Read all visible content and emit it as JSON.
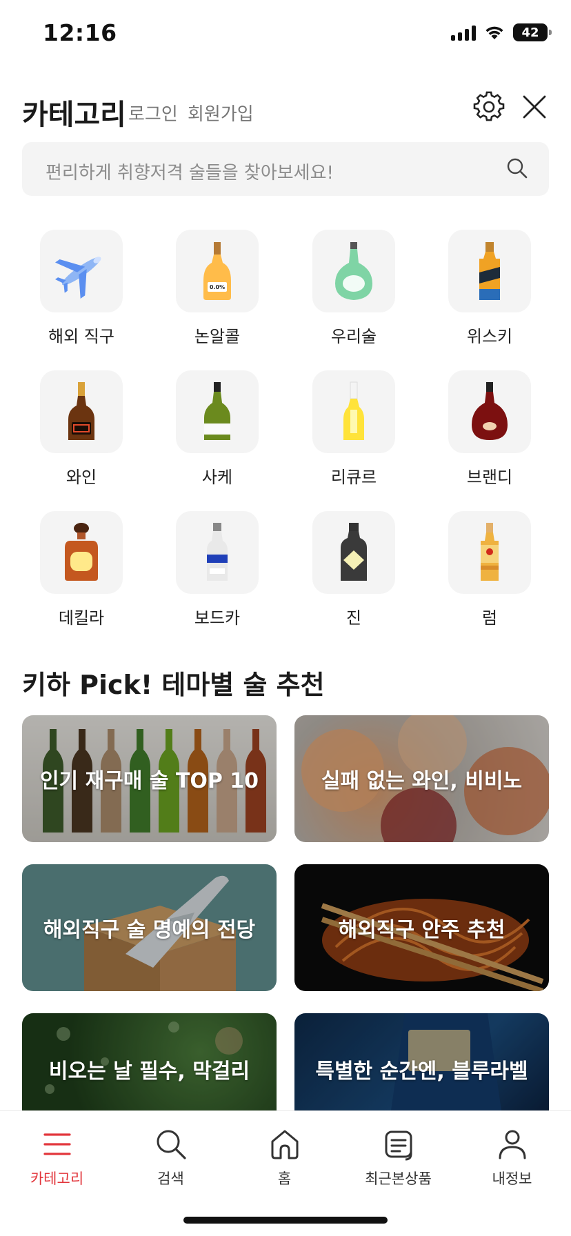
{
  "status": {
    "time": "12:16",
    "battery": "42"
  },
  "header": {
    "title": "카테고리",
    "login": "로그인",
    "signup": "회원가입"
  },
  "search": {
    "placeholder": "편리하게 취향저격 술들을 찾아보세요!"
  },
  "categories": [
    {
      "label": "해외 직구",
      "icon": "airplane-icon"
    },
    {
      "label": "논알콜",
      "icon": "non-alcohol-bottle-icon",
      "badge": "0.0%"
    },
    {
      "label": "우리술",
      "icon": "korean-liquor-bottle-icon"
    },
    {
      "label": "위스키",
      "icon": "whisky-bottle-icon"
    },
    {
      "label": "와인",
      "icon": "wine-bottle-icon"
    },
    {
      "label": "사케",
      "icon": "sake-bottle-icon"
    },
    {
      "label": "리큐르",
      "icon": "liqueur-bottle-icon"
    },
    {
      "label": "브랜디",
      "icon": "brandy-bottle-icon"
    },
    {
      "label": "데킬라",
      "icon": "tequila-bottle-icon"
    },
    {
      "label": "보드카",
      "icon": "vodka-bottle-icon"
    },
    {
      "label": "진",
      "icon": "gin-bottle-icon"
    },
    {
      "label": "럼",
      "icon": "rum-bottle-icon"
    }
  ],
  "section": {
    "title": "키하 Pick! 테마별 술 추천"
  },
  "themes": [
    {
      "label": "인기 재구매 술 TOP 10"
    },
    {
      "label": "실패 없는 와인, 비비노"
    },
    {
      "label": "해외직구 술 명예의 전당"
    },
    {
      "label": "해외직구 안주 추천"
    },
    {
      "label": "비오는 날 필수, 막걸리"
    },
    {
      "label": "특별한 순간엔, 블루라벨"
    }
  ],
  "tabs": [
    {
      "label": "카테고리",
      "icon": "menu-icon",
      "active": true
    },
    {
      "label": "검색",
      "icon": "search-icon"
    },
    {
      "label": "홈",
      "icon": "home-icon"
    },
    {
      "label": "최근본상품",
      "icon": "recent-items-icon"
    },
    {
      "label": "내정보",
      "icon": "profile-icon"
    }
  ],
  "colors": {
    "accent": "#e2363c",
    "tile_bg": "#f4f4f4"
  }
}
